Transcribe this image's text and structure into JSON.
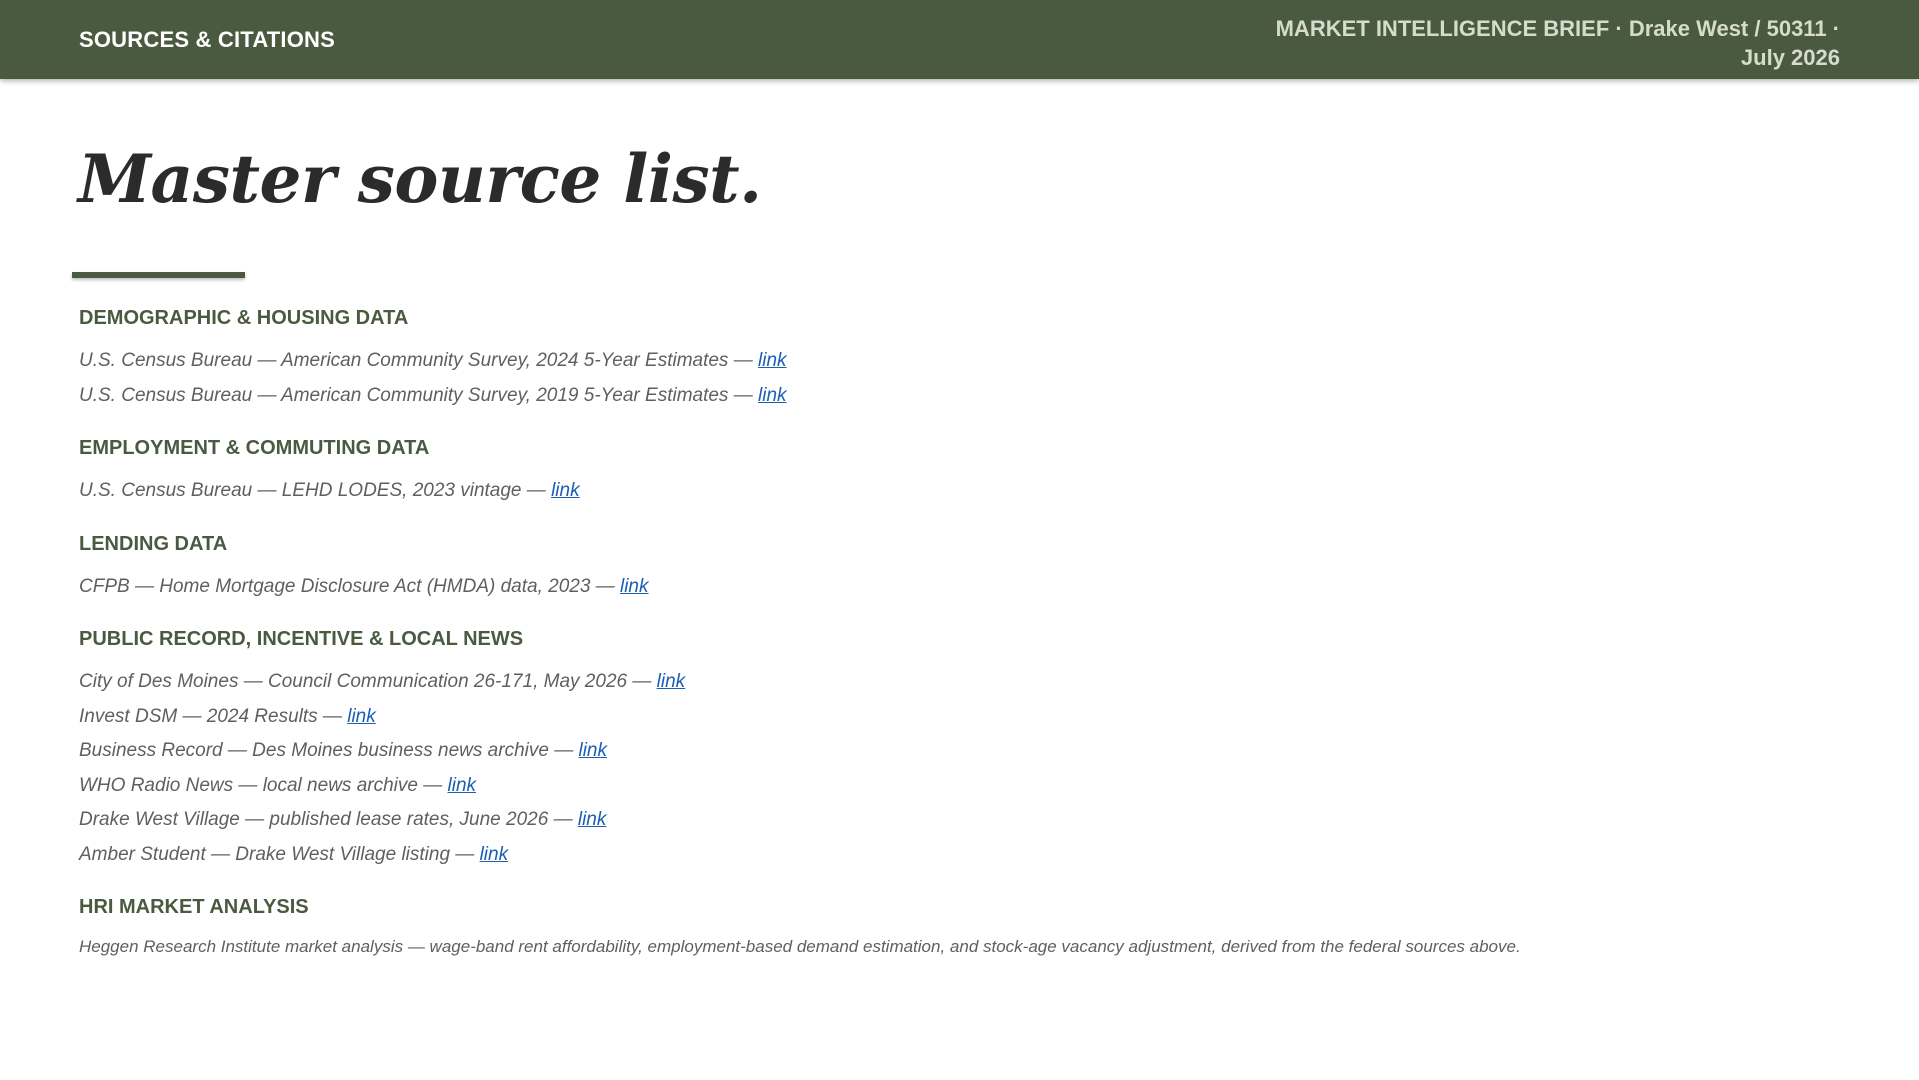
{
  "header": {
    "left_label": "SOURCES & CITATIONS",
    "right_line1": "MARKET INTELLIGENCE BRIEF · Drake West / 50311 ·",
    "right_line2": "July 2026"
  },
  "title": "Master source list.",
  "colors": {
    "header_bg": "#4a5a40",
    "heading": "#4a5a40",
    "link": "#1a5fb4"
  },
  "sections": [
    {
      "heading": "DEMOGRAPHIC & HOUSING DATA",
      "items": [
        {
          "text": "U.S. Census Bureau — American Community Survey, 2024 5-Year Estimates — ",
          "link": "link"
        },
        {
          "text": "U.S. Census Bureau — American Community Survey, 2019 5-Year Estimates — ",
          "link": "link"
        }
      ]
    },
    {
      "heading": "EMPLOYMENT & COMMUTING DATA",
      "items": [
        {
          "text": "U.S. Census Bureau — LEHD LODES, 2023 vintage — ",
          "link": "link"
        }
      ]
    },
    {
      "heading": "LENDING DATA",
      "items": [
        {
          "text": "CFPB — Home Mortgage Disclosure Act (HMDA) data, 2023 — ",
          "link": "link"
        }
      ]
    },
    {
      "heading": "PUBLIC RECORD, INCENTIVE & LOCAL NEWS",
      "items": [
        {
          "text": "City of Des Moines — Council Communication 26-171, May 2026 — ",
          "link": "link"
        },
        {
          "text": "Invest DSM — 2024 Results — ",
          "link": "link"
        },
        {
          "text": "Business Record — Des Moines business news archive — ",
          "link": "link"
        },
        {
          "text": "WHO Radio News — local news archive — ",
          "link": "link"
        },
        {
          "text": "Drake West Village — published lease rates, June 2026 — ",
          "link": "link"
        },
        {
          "text": "Amber Student — Drake West Village listing — ",
          "link": "link"
        }
      ]
    }
  ],
  "analysis": {
    "heading": "HRI MARKET ANALYSIS",
    "text": "Heggen Research Institute market analysis — wage-band rent affordability, employment-based demand estimation, and stock-age vacancy adjustment, derived from the federal sources above."
  }
}
